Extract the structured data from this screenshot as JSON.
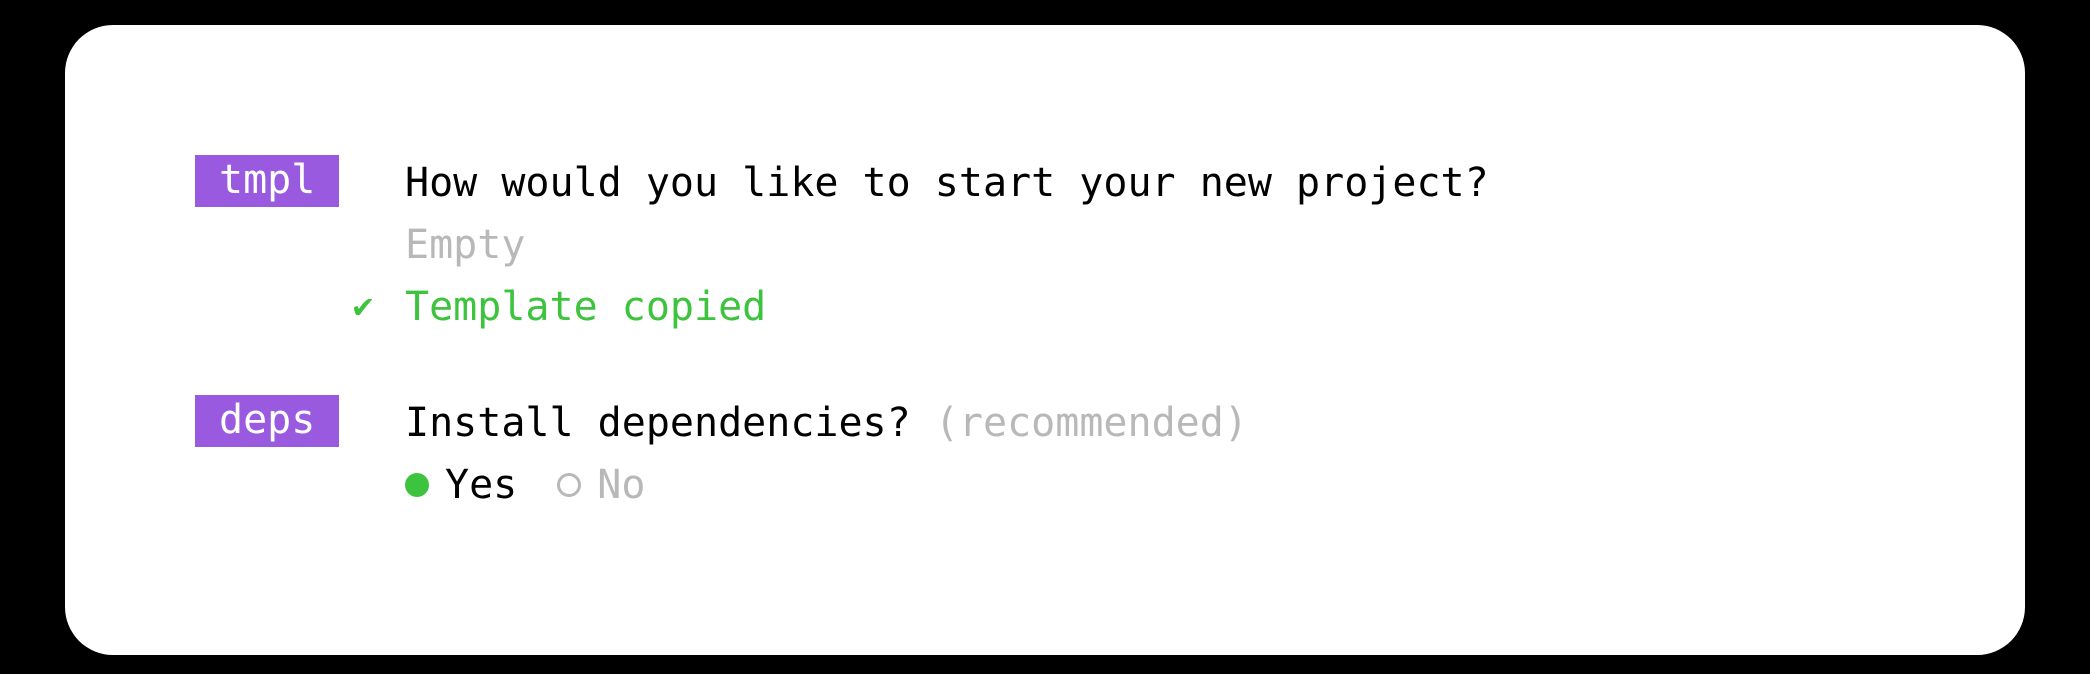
{
  "steps": {
    "tmpl": {
      "tag": "tmpl",
      "question": "How would you like to start your new project?",
      "answer": "Empty",
      "status": "Template copied"
    },
    "deps": {
      "tag": "deps",
      "question": "Install dependencies?",
      "hint": "(recommended)",
      "options": {
        "yes": "Yes",
        "no": "No"
      },
      "selected": "yes"
    }
  }
}
